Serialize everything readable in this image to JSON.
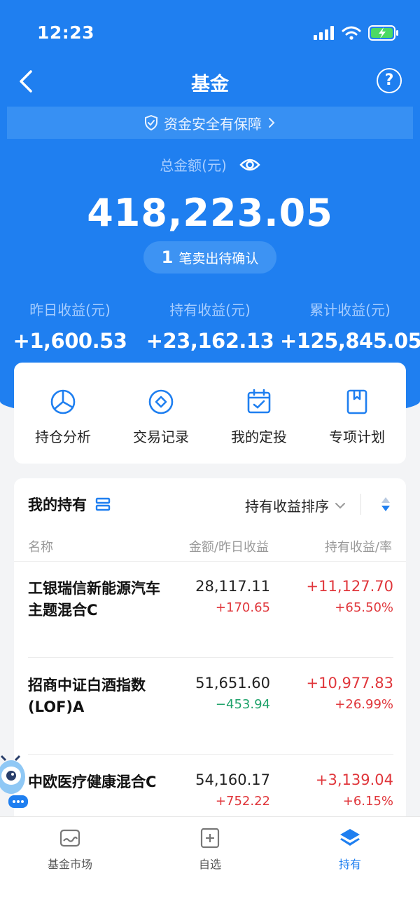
{
  "status_bar": {
    "time": "12:23"
  },
  "nav": {
    "title": "基金"
  },
  "security": {
    "text": "资金安全有保障"
  },
  "total": {
    "label": "总金额(元)",
    "value": "418,223.05"
  },
  "pending": {
    "count": "1",
    "text": "笔卖出待确认"
  },
  "stats": [
    {
      "label": "昨日收益(元)",
      "value": "+1,600.53"
    },
    {
      "label": "持有收益(元)",
      "value": "+23,162.13"
    },
    {
      "label": "累计收益(元)",
      "value": "+125,845.05"
    }
  ],
  "actions": [
    {
      "label": "持仓分析",
      "icon": "pie-chart-icon"
    },
    {
      "label": "交易记录",
      "icon": "diamond-circle-icon"
    },
    {
      "label": "我的定投",
      "icon": "calendar-check-icon"
    },
    {
      "label": "专项计划",
      "icon": "bookmark-icon"
    }
  ],
  "holdings": {
    "title": "我的持有",
    "sort_label": "持有收益排序",
    "columns": {
      "name": "名称",
      "amount": "金额/昨日收益",
      "profit": "持有收益/率"
    },
    "rows": [
      {
        "name": "工银瑞信新能源汽车主题混合C",
        "amount": "28,117.11",
        "daily": "+170.65",
        "profit": "+11,127.70",
        "rate": "+65.50%"
      },
      {
        "name": "招商中证白酒指数(LOF)A",
        "amount": "51,651.60",
        "daily": "−453.94",
        "profit": "+10,977.83",
        "rate": "+26.99%"
      },
      {
        "name": "中欧医疗健康混合C",
        "amount": "54,160.17",
        "daily": "+752.22",
        "profit": "+3,139.04",
        "rate": "+6.15%"
      }
    ]
  },
  "tabbar": [
    {
      "label": "基金市场",
      "icon": "market-icon"
    },
    {
      "label": "自选",
      "icon": "add-favorite-icon"
    },
    {
      "label": "持有",
      "icon": "layers-icon"
    }
  ],
  "colors": {
    "primary": "#1f7ff0",
    "gain": "#e0363b",
    "loss": "#1ea26a"
  }
}
